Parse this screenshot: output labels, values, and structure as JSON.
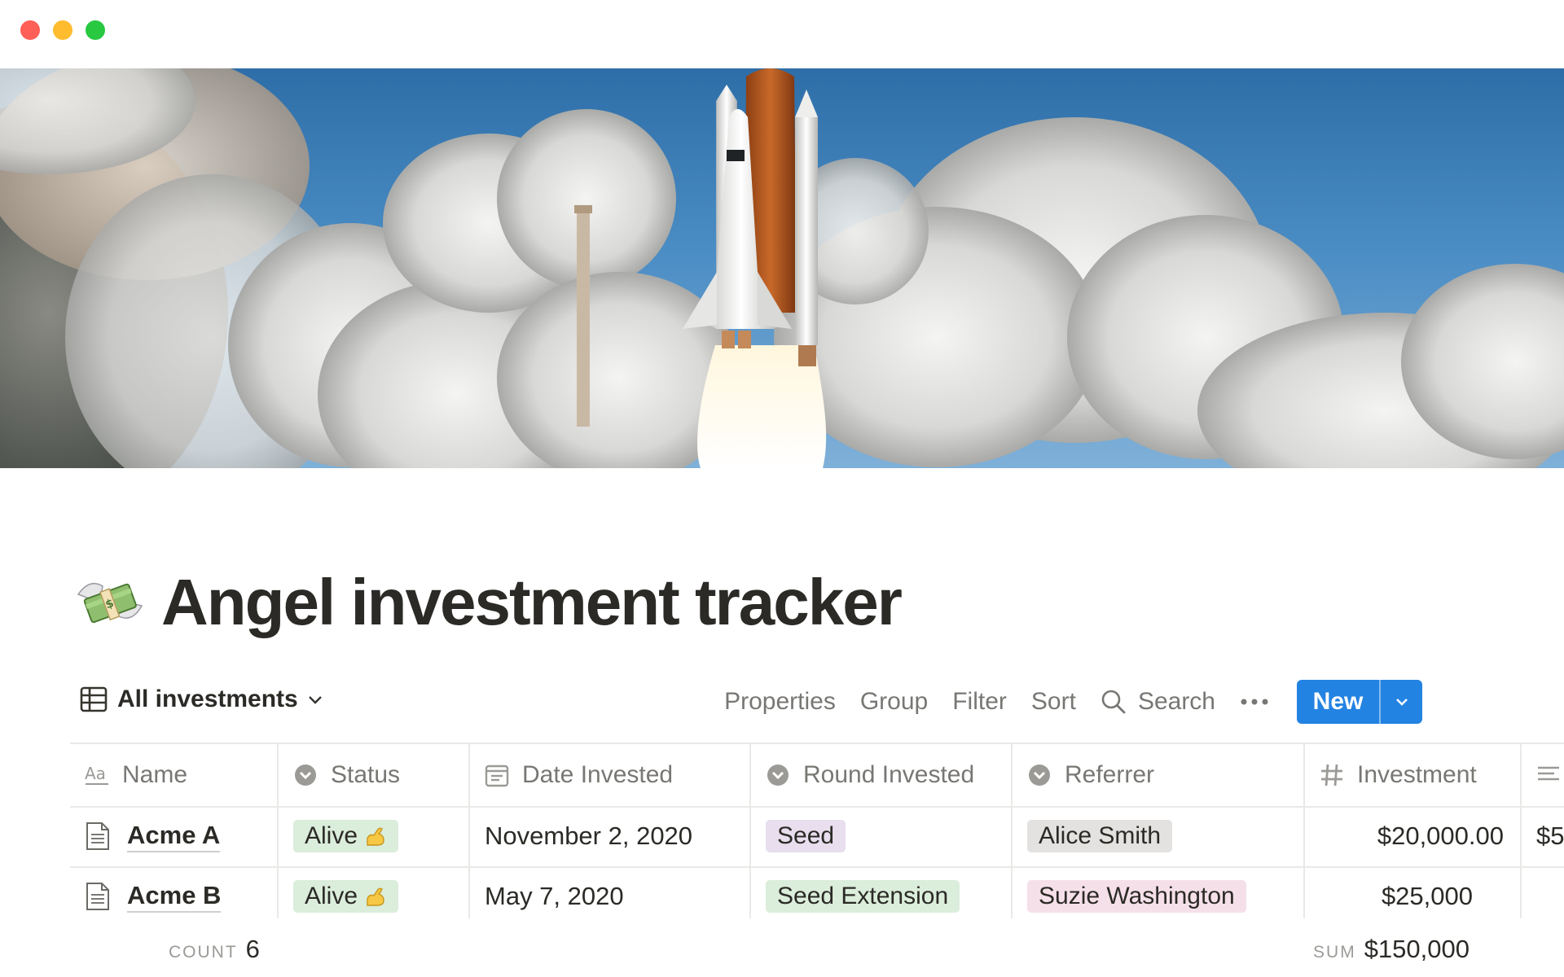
{
  "window": {
    "controls": [
      "close",
      "minimize",
      "zoom"
    ]
  },
  "cover": {
    "description_icon": "space-shuttle-launch-image"
  },
  "page": {
    "icon": "money-with-wings-emoji",
    "title": "Angel investment tracker"
  },
  "toolbar": {
    "view_label": "All investments",
    "properties_label": "Properties",
    "group_label": "Group",
    "filter_label": "Filter",
    "sort_label": "Sort",
    "search_label": "Search",
    "new_label": "New"
  },
  "table": {
    "columns": [
      {
        "label": "Name",
        "icon": "text-aa-icon"
      },
      {
        "label": "Status",
        "icon": "select-icon"
      },
      {
        "label": "Date Invested",
        "icon": "calendar-icon"
      },
      {
        "label": "Round Invested",
        "icon": "select-icon"
      },
      {
        "label": "Referrer",
        "icon": "select-icon"
      },
      {
        "label": "Investment",
        "icon": "hash-icon"
      }
    ],
    "rows": [
      {
        "name": "Acme A",
        "status": "Alive",
        "date": "November 2, 2020",
        "round": "Seed",
        "referrer": "Alice Smith",
        "investment": "$20,000.00",
        "extra": "$5"
      },
      {
        "name": "Acme B",
        "status": "Alive",
        "date": "May 7, 2020",
        "round": "Seed Extension",
        "referrer": "Suzie Washington",
        "investment": "$25,000"
      }
    ],
    "footer": {
      "count_label": "COUNT",
      "count_value": "6",
      "sum_label": "SUM",
      "sum_value": "$150,000"
    }
  },
  "colors": {
    "accent": "#2383e2",
    "green_tag": "#dbeddb",
    "purple_tag": "#e8deee",
    "gray_tag": "#e3e2e0",
    "pink_tag": "#f5e0e9"
  }
}
